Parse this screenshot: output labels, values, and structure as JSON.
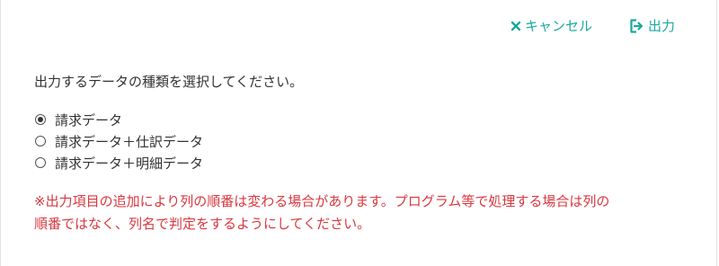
{
  "toolbar": {
    "cancel_label": "キャンセル",
    "cancel_icon": "close-icon",
    "export_label": "出力",
    "export_icon": "export-icon",
    "accent_color": "#1aa8a0"
  },
  "prompt": "出力するデータの種類を選択してください。",
  "options": [
    {
      "label": "請求データ",
      "checked": true
    },
    {
      "label": "請求データ＋仕訳データ",
      "checked": false
    },
    {
      "label": "請求データ＋明細データ",
      "checked": false
    }
  ],
  "notice": {
    "line1": "※出力項目の追加により列の順番は変わる場合があります。プログラム等で処理する場合は列の",
    "line2": "順番ではなく、列名で判定をするようにしてください。",
    "color": "#d9383f"
  }
}
